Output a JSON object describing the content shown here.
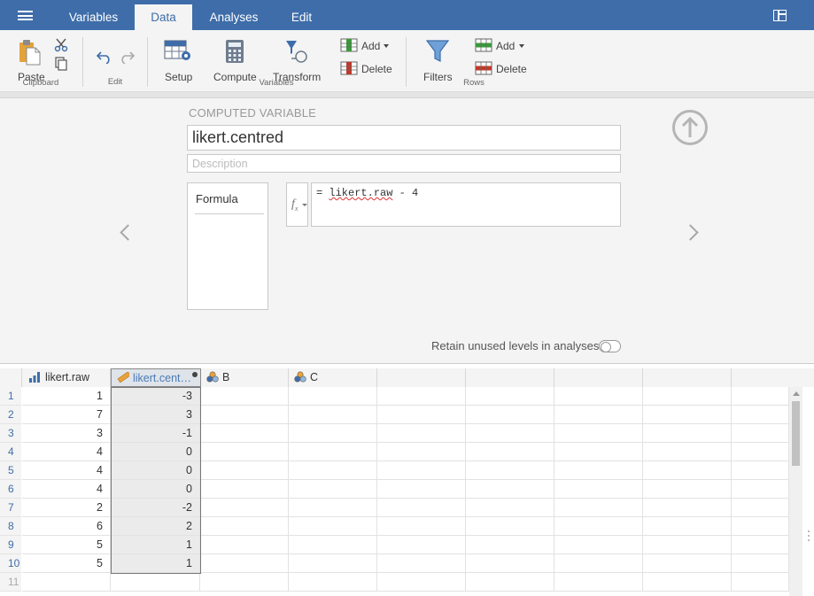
{
  "menubar": {
    "tabs": [
      {
        "label": "Variables",
        "active": false
      },
      {
        "label": "Data",
        "active": true
      },
      {
        "label": "Analyses",
        "active": false
      },
      {
        "label": "Edit",
        "active": false
      }
    ]
  },
  "ribbon": {
    "paste": "Paste",
    "clipboard_group": "Clipboard",
    "edit_group": "Edit",
    "setup": "Setup",
    "compute": "Compute",
    "transform": "Transform",
    "variables_add": "Add",
    "variables_delete": "Delete",
    "variables_group": "Variables",
    "filters": "Filters",
    "rows_add": "Add",
    "rows_delete": "Delete",
    "rows_group": "Rows"
  },
  "computed": {
    "title": "COMPUTED VARIABLE",
    "name": "likert.centred",
    "description_placeholder": "Description",
    "formula_tab": "Formula",
    "formula_prefix": "= ",
    "formula_var": "likert.raw",
    "formula_rest": " - 4",
    "retain_label": "Retain unused levels in analyses",
    "retain_on": false
  },
  "sheet": {
    "columns": [
      {
        "label": "likert.raw",
        "icon": "ordinal-icon"
      },
      {
        "label": "likert.cent…",
        "icon": "computed-ruler-icon"
      },
      {
        "label": "B",
        "icon": "nominal-icon"
      },
      {
        "label": "C",
        "icon": "nominal-icon"
      },
      {
        "label": ""
      },
      {
        "label": ""
      },
      {
        "label": ""
      },
      {
        "label": ""
      }
    ],
    "rows": [
      [
        "1",
        "-3"
      ],
      [
        "7",
        "3"
      ],
      [
        "3",
        "-1"
      ],
      [
        "4",
        "0"
      ],
      [
        "4",
        "0"
      ],
      [
        "4",
        "0"
      ],
      [
        "2",
        "-2"
      ],
      [
        "6",
        "2"
      ],
      [
        "5",
        "1"
      ],
      [
        "5",
        "1"
      ]
    ],
    "row_numbers": [
      "1",
      "2",
      "3",
      "4",
      "5",
      "6",
      "7",
      "8",
      "9",
      "10",
      "11"
    ]
  },
  "colors": {
    "accent": "#3e6da9",
    "selected_header": "#dfe4ea",
    "computed_cell": "#ebebeb"
  }
}
